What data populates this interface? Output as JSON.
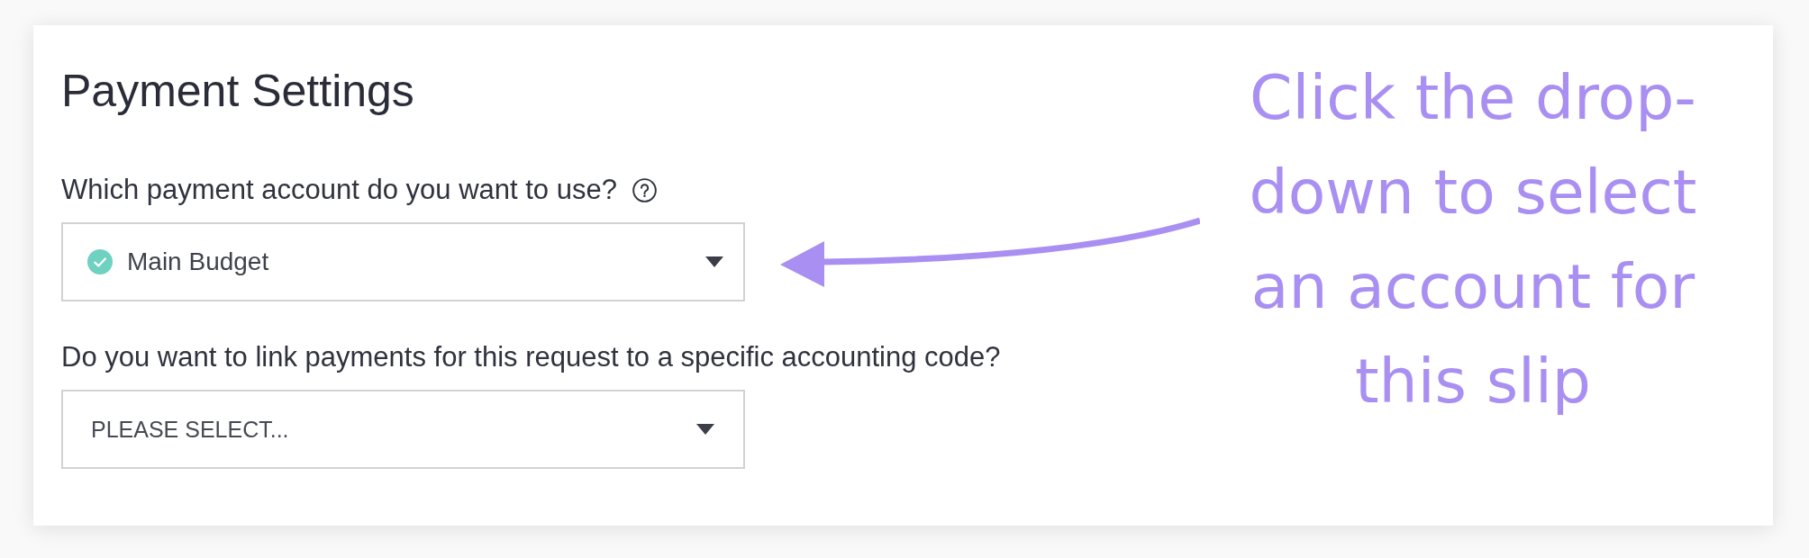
{
  "card": {
    "title": "Payment Settings"
  },
  "questions": [
    {
      "label": "Which payment account do you want to use?",
      "help": true,
      "dropdown": {
        "value": "Main Budget",
        "verified": true
      }
    },
    {
      "label": "Do you want to link payments for this request to a specific accounting code?",
      "help": false,
      "dropdown": {
        "placeholder": "PLEASE SELECT...",
        "verified": false
      }
    }
  ],
  "annotation": {
    "text": "Click the drop-down to select an account for this slip"
  }
}
